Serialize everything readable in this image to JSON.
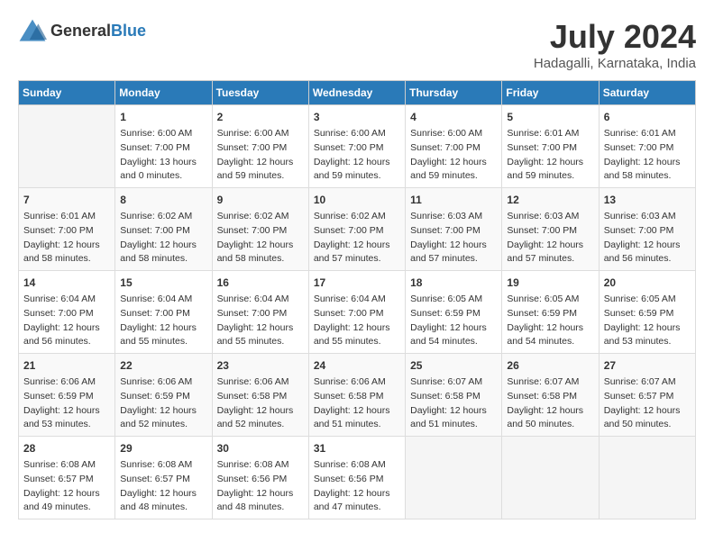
{
  "header": {
    "logo_general": "General",
    "logo_blue": "Blue",
    "month_year": "July 2024",
    "location": "Hadagalli, Karnataka, India"
  },
  "days_of_week": [
    "Sunday",
    "Monday",
    "Tuesday",
    "Wednesday",
    "Thursday",
    "Friday",
    "Saturday"
  ],
  "weeks": [
    [
      {
        "day": "",
        "info": ""
      },
      {
        "day": "1",
        "info": "Sunrise: 6:00 AM\nSunset: 7:00 PM\nDaylight: 13 hours\nand 0 minutes."
      },
      {
        "day": "2",
        "info": "Sunrise: 6:00 AM\nSunset: 7:00 PM\nDaylight: 12 hours\nand 59 minutes."
      },
      {
        "day": "3",
        "info": "Sunrise: 6:00 AM\nSunset: 7:00 PM\nDaylight: 12 hours\nand 59 minutes."
      },
      {
        "day": "4",
        "info": "Sunrise: 6:00 AM\nSunset: 7:00 PM\nDaylight: 12 hours\nand 59 minutes."
      },
      {
        "day": "5",
        "info": "Sunrise: 6:01 AM\nSunset: 7:00 PM\nDaylight: 12 hours\nand 59 minutes."
      },
      {
        "day": "6",
        "info": "Sunrise: 6:01 AM\nSunset: 7:00 PM\nDaylight: 12 hours\nand 58 minutes."
      }
    ],
    [
      {
        "day": "7",
        "info": "Sunrise: 6:01 AM\nSunset: 7:00 PM\nDaylight: 12 hours\nand 58 minutes."
      },
      {
        "day": "8",
        "info": "Sunrise: 6:02 AM\nSunset: 7:00 PM\nDaylight: 12 hours\nand 58 minutes."
      },
      {
        "day": "9",
        "info": "Sunrise: 6:02 AM\nSunset: 7:00 PM\nDaylight: 12 hours\nand 58 minutes."
      },
      {
        "day": "10",
        "info": "Sunrise: 6:02 AM\nSunset: 7:00 PM\nDaylight: 12 hours\nand 57 minutes."
      },
      {
        "day": "11",
        "info": "Sunrise: 6:03 AM\nSunset: 7:00 PM\nDaylight: 12 hours\nand 57 minutes."
      },
      {
        "day": "12",
        "info": "Sunrise: 6:03 AM\nSunset: 7:00 PM\nDaylight: 12 hours\nand 57 minutes."
      },
      {
        "day": "13",
        "info": "Sunrise: 6:03 AM\nSunset: 7:00 PM\nDaylight: 12 hours\nand 56 minutes."
      }
    ],
    [
      {
        "day": "14",
        "info": "Sunrise: 6:04 AM\nSunset: 7:00 PM\nDaylight: 12 hours\nand 56 minutes."
      },
      {
        "day": "15",
        "info": "Sunrise: 6:04 AM\nSunset: 7:00 PM\nDaylight: 12 hours\nand 55 minutes."
      },
      {
        "day": "16",
        "info": "Sunrise: 6:04 AM\nSunset: 7:00 PM\nDaylight: 12 hours\nand 55 minutes."
      },
      {
        "day": "17",
        "info": "Sunrise: 6:04 AM\nSunset: 7:00 PM\nDaylight: 12 hours\nand 55 minutes."
      },
      {
        "day": "18",
        "info": "Sunrise: 6:05 AM\nSunset: 6:59 PM\nDaylight: 12 hours\nand 54 minutes."
      },
      {
        "day": "19",
        "info": "Sunrise: 6:05 AM\nSunset: 6:59 PM\nDaylight: 12 hours\nand 54 minutes."
      },
      {
        "day": "20",
        "info": "Sunrise: 6:05 AM\nSunset: 6:59 PM\nDaylight: 12 hours\nand 53 minutes."
      }
    ],
    [
      {
        "day": "21",
        "info": "Sunrise: 6:06 AM\nSunset: 6:59 PM\nDaylight: 12 hours\nand 53 minutes."
      },
      {
        "day": "22",
        "info": "Sunrise: 6:06 AM\nSunset: 6:59 PM\nDaylight: 12 hours\nand 52 minutes."
      },
      {
        "day": "23",
        "info": "Sunrise: 6:06 AM\nSunset: 6:58 PM\nDaylight: 12 hours\nand 52 minutes."
      },
      {
        "day": "24",
        "info": "Sunrise: 6:06 AM\nSunset: 6:58 PM\nDaylight: 12 hours\nand 51 minutes."
      },
      {
        "day": "25",
        "info": "Sunrise: 6:07 AM\nSunset: 6:58 PM\nDaylight: 12 hours\nand 51 minutes."
      },
      {
        "day": "26",
        "info": "Sunrise: 6:07 AM\nSunset: 6:58 PM\nDaylight: 12 hours\nand 50 minutes."
      },
      {
        "day": "27",
        "info": "Sunrise: 6:07 AM\nSunset: 6:57 PM\nDaylight: 12 hours\nand 50 minutes."
      }
    ],
    [
      {
        "day": "28",
        "info": "Sunrise: 6:08 AM\nSunset: 6:57 PM\nDaylight: 12 hours\nand 49 minutes."
      },
      {
        "day": "29",
        "info": "Sunrise: 6:08 AM\nSunset: 6:57 PM\nDaylight: 12 hours\nand 48 minutes."
      },
      {
        "day": "30",
        "info": "Sunrise: 6:08 AM\nSunset: 6:56 PM\nDaylight: 12 hours\nand 48 minutes."
      },
      {
        "day": "31",
        "info": "Sunrise: 6:08 AM\nSunset: 6:56 PM\nDaylight: 12 hours\nand 47 minutes."
      },
      {
        "day": "",
        "info": ""
      },
      {
        "day": "",
        "info": ""
      },
      {
        "day": "",
        "info": ""
      }
    ]
  ]
}
